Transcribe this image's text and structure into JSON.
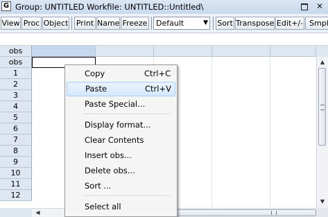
{
  "window": {
    "icon_letter": "G",
    "title": "Group: UNTITLED   Workfile: UNTITLED::Untitled\\",
    "close_glyph": "✕"
  },
  "toolbar": {
    "buttons": [
      "View",
      "Proc",
      "Object",
      "Print",
      "Name",
      "Freeze",
      "Sort",
      "Transpose",
      "Edit+/-",
      "Smpl"
    ],
    "dropdown_value": "Default",
    "dropdown_caret": "▼"
  },
  "grid": {
    "header_label": "obs",
    "subheader_label": "obs",
    "row_labels": [
      "1",
      "2",
      "3",
      "4",
      "5",
      "6",
      "7",
      "8",
      "9",
      "10",
      "11",
      "12"
    ]
  },
  "scrollbars": {
    "up": "▲",
    "down": "▼",
    "left": "◀",
    "right": "▶"
  },
  "context_menu": {
    "copy": {
      "label": "Copy",
      "shortcut": "Ctrl+C"
    },
    "paste": {
      "label": "Paste",
      "shortcut": "Ctrl+V"
    },
    "paste_special": "Paste Special...",
    "display_format": "Display format...",
    "clear_contents": "Clear Contents",
    "insert_obs": "Insert obs...",
    "delete_obs": "Delete obs...",
    "sort": "Sort ...",
    "select_all": "Select all"
  }
}
